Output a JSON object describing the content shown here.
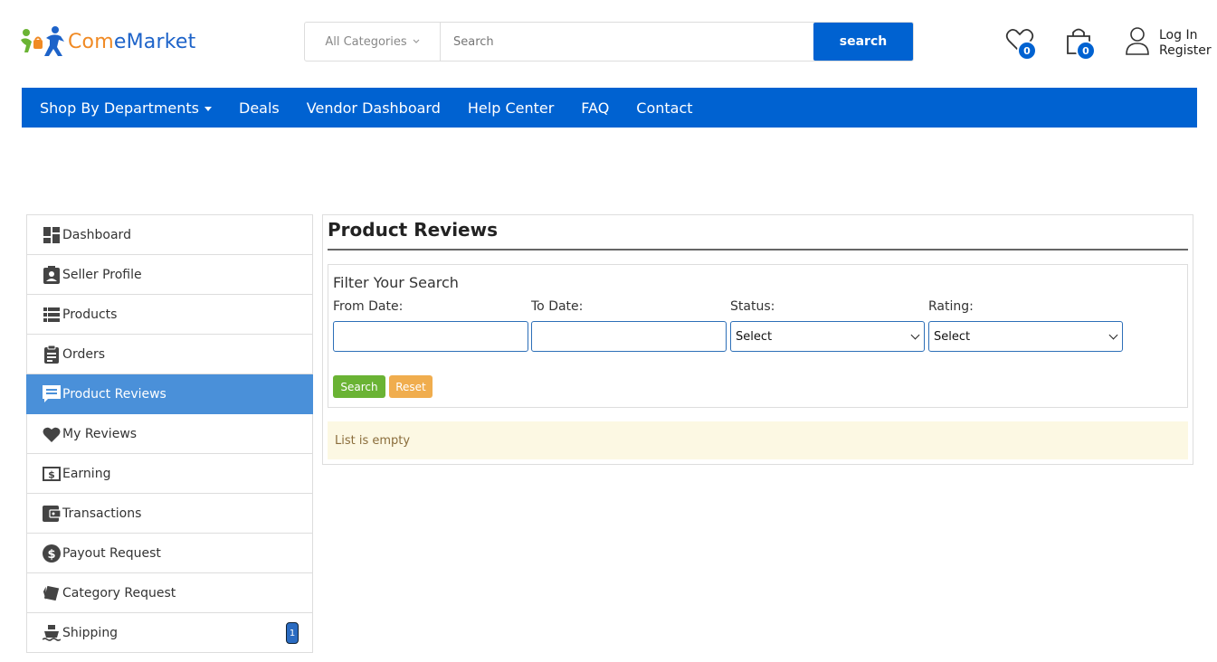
{
  "brand": {
    "name_part1": "Com",
    "name_part2": "eMarket"
  },
  "search": {
    "category": "All Categories",
    "placeholder": "Search",
    "button_label": "search"
  },
  "header": {
    "wishlist_count": "0",
    "cart_count": "0",
    "login_label": "Log In",
    "register_label": "Register"
  },
  "nav": {
    "items": [
      "Shop By Departments",
      "Deals",
      "Vendor Dashboard",
      "Help Center",
      "FAQ",
      "Contact"
    ]
  },
  "sidebar": {
    "items": [
      {
        "label": "Dashboard",
        "icon": "dashboard-icon"
      },
      {
        "label": "Seller Profile",
        "icon": "profile-icon"
      },
      {
        "label": "Products",
        "icon": "list-icon"
      },
      {
        "label": "Orders",
        "icon": "clipboard-icon"
      },
      {
        "label": "Product Reviews",
        "icon": "comment-icon",
        "active": true
      },
      {
        "label": "My Reviews",
        "icon": "heart-icon"
      },
      {
        "label": "Earning",
        "icon": "dollar-bill-icon"
      },
      {
        "label": "Transactions",
        "icon": "wallet-icon"
      },
      {
        "label": "Payout Request",
        "icon": "dollar-circle-icon"
      },
      {
        "label": "Category Request",
        "icon": "tags-icon"
      },
      {
        "label": "Shipping",
        "icon": "ship-icon",
        "badge": "1"
      }
    ]
  },
  "main": {
    "title": "Product Reviews",
    "filter": {
      "title": "Filter Your Search",
      "from_label": "From Date:",
      "to_label": "To Date:",
      "status_label": "Status:",
      "status_value": "Select",
      "rating_label": "Rating:",
      "rating_value": "Select",
      "search_label": "Search",
      "reset_label": "Reset"
    },
    "empty_message": "List is empty"
  },
  "colors": {
    "primary": "#0062d1",
    "active": "#4a90d9",
    "success": "#6ab334",
    "warning": "#f0ad4e"
  }
}
